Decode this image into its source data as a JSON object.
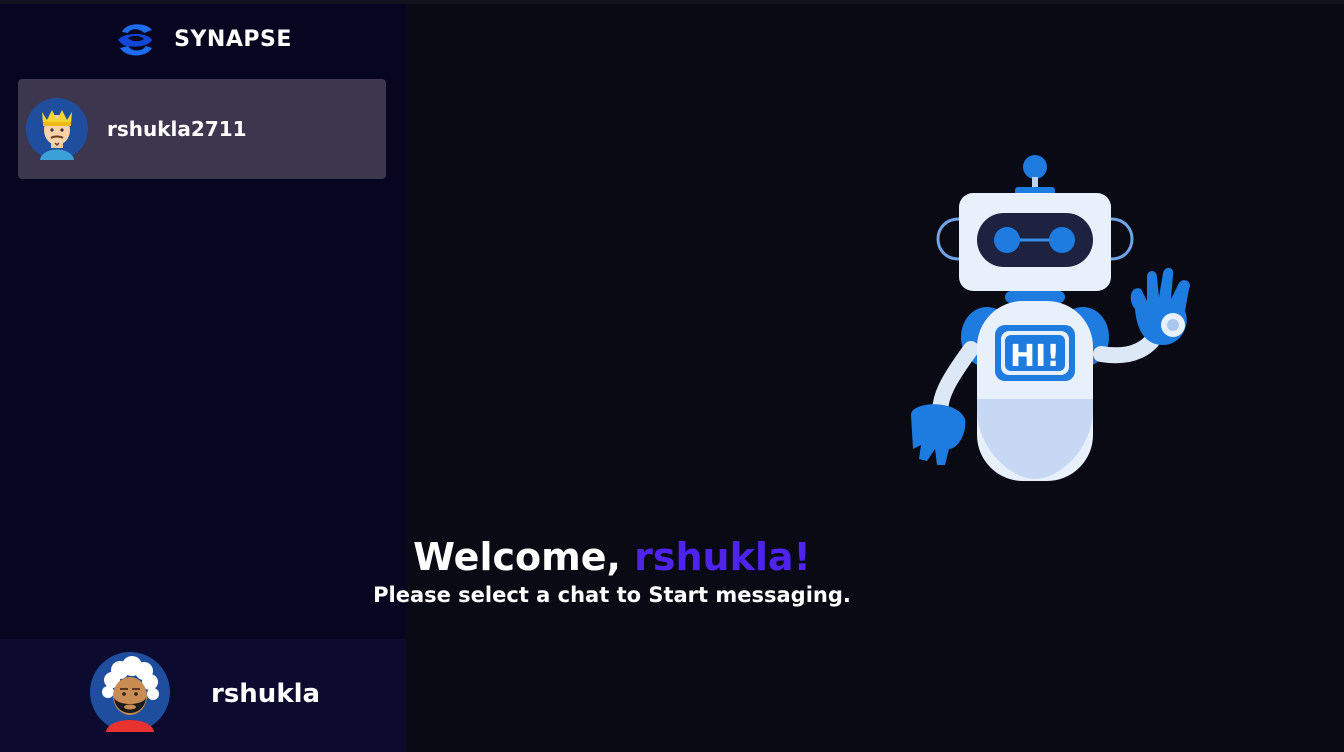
{
  "app": {
    "name": "SYNAPSE",
    "logo_icon": "synapse-logo-icon",
    "accent_color": "#4f23ee"
  },
  "sidebar": {
    "contacts": [
      {
        "username": "rshukla2711",
        "avatar": "king-avatar-icon",
        "selected": true
      }
    ]
  },
  "current_user": {
    "username": "rshukla",
    "avatar": "bearded-man-avatar-icon"
  },
  "welcome": {
    "greeting": "Welcome, ",
    "username": "rshukla!",
    "subtitle": "Please select a chat to Start messaging.",
    "illustration": "robot-waving-hi-icon",
    "illustration_text": "HI!"
  }
}
